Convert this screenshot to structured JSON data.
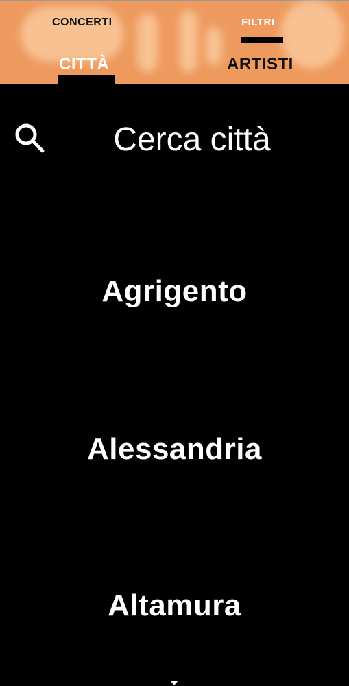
{
  "header": {
    "tabs_top": [
      "CONCERTI",
      "FILTRI"
    ],
    "tabs_bottom": [
      "CITTÀ",
      "ARTISTI"
    ],
    "bg_color": "#ee9a5e"
  },
  "search": {
    "icon": "search-icon",
    "placeholder": "Cerca città"
  },
  "cities": [
    "Agrigento",
    "Alessandria",
    "Altamura"
  ],
  "scroll_indicator": "chevron-down-icon"
}
